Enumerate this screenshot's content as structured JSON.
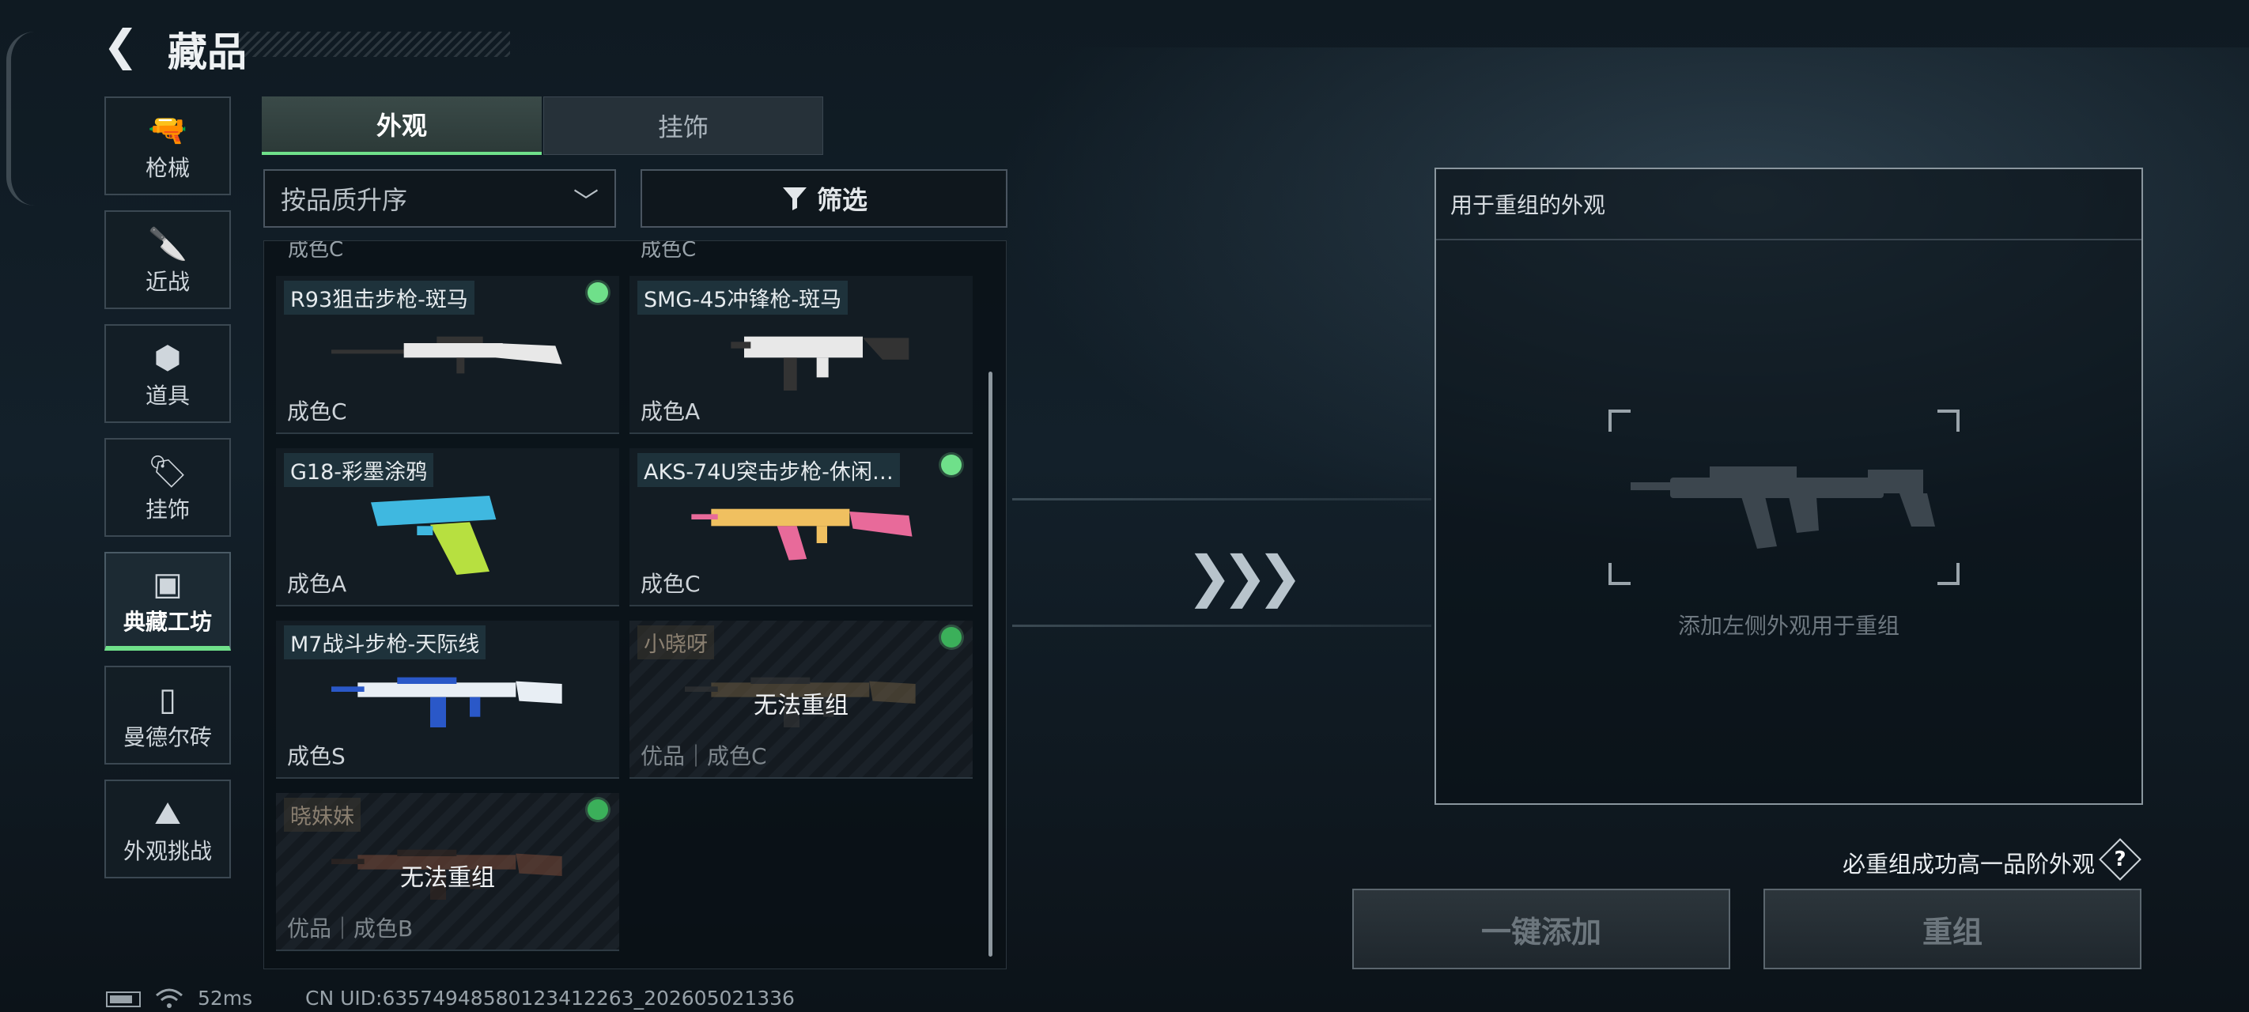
{
  "header": {
    "back_icon": "chevron-left-icon",
    "title": "藏品"
  },
  "sidebar": {
    "items": [
      {
        "label": "枪械",
        "icon": "pistol-icon",
        "glyph": "🔫",
        "active": false
      },
      {
        "label": "近战",
        "icon": "knife-icon",
        "glyph": "🔪",
        "active": false
      },
      {
        "label": "道具",
        "icon": "items-icon",
        "glyph": "⬢",
        "active": false
      },
      {
        "label": "挂饰",
        "icon": "charm-icon",
        "glyph": "🏷",
        "active": false
      },
      {
        "label": "典藏工坊",
        "icon": "workshop-icon",
        "glyph": "▣",
        "active": true
      },
      {
        "label": "曼德尔砖",
        "icon": "mandel-brick-icon",
        "glyph": "▯",
        "active": false
      },
      {
        "label": "外观挑战",
        "icon": "challenge-icon",
        "glyph": "⛰",
        "active": false
      }
    ]
  },
  "tabs": [
    {
      "label": "外观",
      "active": true
    },
    {
      "label": "挂饰",
      "active": false
    }
  ],
  "sort": {
    "value": "按品质升序",
    "icon": "chevron-down-icon"
  },
  "filter": {
    "label": "筛选",
    "icon": "filter-icon"
  },
  "cut_row": [
    "成色C",
    "成色C"
  ],
  "cards": [
    {
      "name": "R93狙击步枪-斑马",
      "grade": "成色C",
      "selected": true,
      "disabled": false,
      "overlay": "",
      "gun": "sniper",
      "colors": [
        "#e8e8e8",
        "#333"
      ]
    },
    {
      "name": "SMG-45冲锋枪-斑马",
      "grade": "成色A",
      "selected": false,
      "disabled": false,
      "overlay": "",
      "gun": "smg",
      "colors": [
        "#e8e8e8",
        "#333"
      ]
    },
    {
      "name": "G18-彩墨涂鸦",
      "grade": "成色A",
      "selected": false,
      "disabled": false,
      "overlay": "",
      "gun": "pistol",
      "colors": [
        "#3fb8e0",
        "#b7e040"
      ]
    },
    {
      "name": "AKS-74U突击步枪-休闲…",
      "grade": "成色C",
      "selected": true,
      "disabled": false,
      "overlay": "",
      "gun": "ak",
      "colors": [
        "#f0c060",
        "#e86a9a"
      ]
    },
    {
      "name": "M7战斗步枪-天际线",
      "grade": "成色S",
      "selected": false,
      "disabled": false,
      "overlay": "",
      "gun": "rifle",
      "colors": [
        "#e8eef4",
        "#2a58c8"
      ]
    },
    {
      "name": "小晓呀",
      "grade": "优品｜成色C",
      "selected": true,
      "disabled": true,
      "overlay": "无法重组",
      "gun": "rifle",
      "colors": [
        "#6a5a40",
        "#3a3a3a"
      ]
    },
    {
      "name": "晓妹妹",
      "grade": "优品｜成色B",
      "selected": true,
      "disabled": true,
      "overlay": "无法重组",
      "gun": "rifle",
      "colors": [
        "#7a4a38",
        "#3a2a22"
      ]
    }
  ],
  "recombine": {
    "header": "用于重组的外观",
    "hint": "添加左侧外观用于重组",
    "note": "必重组成功高一品阶外观",
    "help_icon": "question-icon",
    "help_label": "?",
    "add_button": "一键添加",
    "recombine_button": "重组",
    "arrows_icon": "triple-chevron-right-icon"
  },
  "footer": {
    "ping": "52ms",
    "uid": "CN UID:63574948580123412263_202605021336",
    "battery_icon": "battery-icon",
    "wifi_icon": "wifi-icon"
  }
}
